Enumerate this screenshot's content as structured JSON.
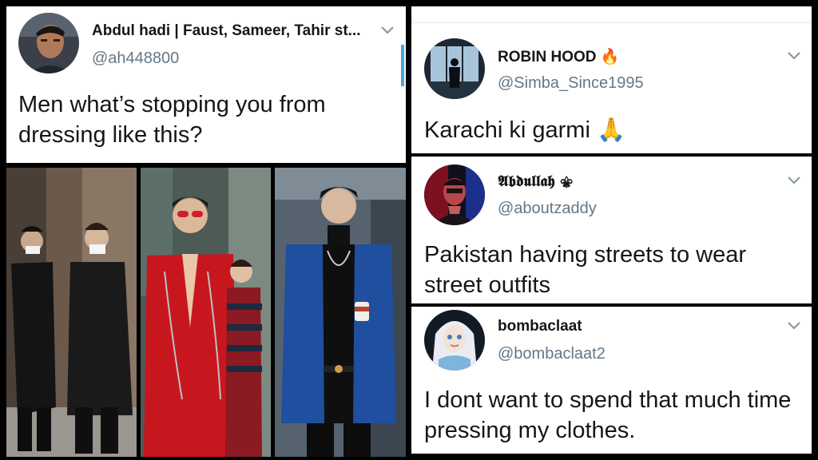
{
  "tweets": [
    {
      "name": "Abdul hadi | Faust, Sameer, Tahir st...",
      "handle": "@ah448800",
      "text": "Men what’s stopping you from dressing like this?",
      "avatar_icon": "man-portrait-avatar",
      "menu_icon": "chevron-down-icon"
    },
    {
      "name": "ROBIN HOOD 🔥",
      "handle": "@Simba_Since1995",
      "text": "Karachi ki garmi 🙏",
      "avatar_icon": "silhouette-window-avatar",
      "menu_icon": "chevron-down-icon"
    },
    {
      "name": "𝕬𝖇𝖉𝖚𝖑𝖑𝖆𝖍 ⚜",
      "handle": "@aboutzaddy",
      "text": "Pakistan having streets to wear street outfits",
      "avatar_icon": "red-lit-man-avatar",
      "menu_icon": "chevron-down-icon"
    },
    {
      "name": "bombaclaat",
      "handle": "@bombaclaat2",
      "text": "I dont want to spend that much time pressing my clothes.",
      "avatar_icon": "elsa-avatar",
      "menu_icon": "chevron-down-icon"
    }
  ],
  "photos": [
    {
      "label": "black-outfit-photo"
    },
    {
      "label": "red-outfit-photo"
    },
    {
      "label": "blue-blazer-photo"
    }
  ],
  "colors": {
    "name": "#14171a",
    "handle": "#657786",
    "chevron": "#8899a6",
    "background": "#000000",
    "card": "#ffffff",
    "accent_red": "#d21e2a",
    "accent_blue": "#1f4f9e"
  }
}
